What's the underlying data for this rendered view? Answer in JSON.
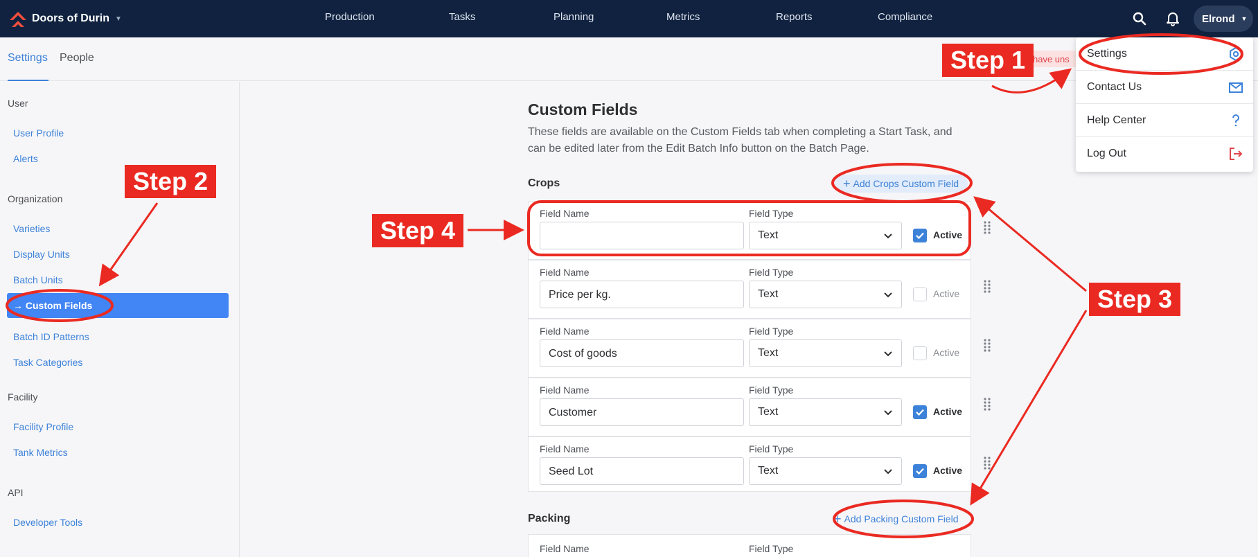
{
  "topbar": {
    "brand": "Doors of Durin",
    "nav": [
      "Production",
      "Tasks",
      "Planning",
      "Metrics",
      "Reports",
      "Compliance"
    ],
    "user": "Elrond"
  },
  "subheader": {
    "tabs": [
      "Settings",
      "People"
    ],
    "unsaved_text": "have uns"
  },
  "sidebar": {
    "sections": [
      {
        "heading": "User",
        "items": [
          "User Profile",
          "Alerts"
        ]
      },
      {
        "heading": "Organization",
        "items": [
          "Varieties",
          "Display Units",
          "Batch Units",
          "Custom Fields",
          "Batch ID Patterns",
          "Task Categories"
        ]
      },
      {
        "heading": "Facility",
        "items": [
          "Facility Profile",
          "Tank Metrics"
        ]
      },
      {
        "heading": "API",
        "items": [
          "Developer Tools"
        ]
      }
    ],
    "active_prefix": "→",
    "active_label": "Custom Fields"
  },
  "main": {
    "title": "Custom Fields",
    "description": "These fields are available on the Custom Fields tab when completing a Start Task, and can be edited later from the Edit Batch Info button on the Batch Page.",
    "crops": {
      "label": "Crops",
      "add_label": "Add Crops Custom Field",
      "field_name_label": "Field Name",
      "field_type_label": "Field Type",
      "active_label": "Active",
      "fields": [
        {
          "name": "",
          "type": "Text",
          "active": true
        },
        {
          "name": "Price per kg.",
          "type": "Text",
          "active": false
        },
        {
          "name": "Cost of goods",
          "type": "Text",
          "active": false
        },
        {
          "name": "Customer",
          "type": "Text",
          "active": true
        },
        {
          "name": "Seed Lot",
          "type": "Text",
          "active": true
        }
      ]
    },
    "packing": {
      "label": "Packing",
      "add_label": "Add Packing Custom Field",
      "field_name_label": "Field Name",
      "field_type_label": "Field Type"
    }
  },
  "menu": {
    "items": [
      {
        "label": "Settings",
        "icon": "gear-icon"
      },
      {
        "label": "Contact Us",
        "icon": "mail-icon"
      },
      {
        "label": "Help Center",
        "icon": "question-icon"
      },
      {
        "label": "Log Out",
        "icon": "logout-icon"
      }
    ]
  },
  "annotations": {
    "step1": "Step 1",
    "step2": "Step 2",
    "step3": "Step 3",
    "step4": "Step 4"
  },
  "colors": {
    "topbar": "#10223f",
    "accent": "#3d82d9",
    "annotation": "#ea2a22"
  }
}
